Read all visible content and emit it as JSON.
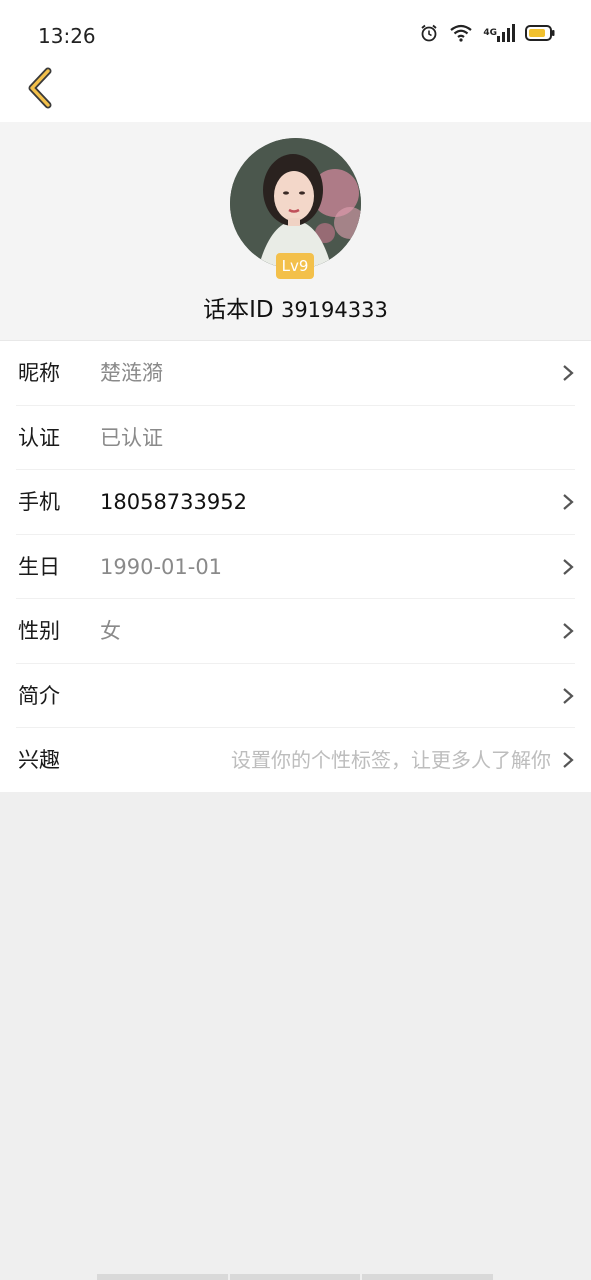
{
  "status_bar": {
    "time": "13:26",
    "network": "4G",
    "icons": [
      "alarm-icon",
      "wifi-icon",
      "signal-icon",
      "battery-icon"
    ],
    "battery_color": "#f2c12e"
  },
  "nav": {
    "back_icon": "chevron-left-icon",
    "back_color": "#f3c04a"
  },
  "profile": {
    "level_badge": "Lv9",
    "id_label": "话本ID",
    "id_value": "39194333"
  },
  "rows": [
    {
      "label": "昵称",
      "value": "楚涟漪"
    },
    {
      "label": "认证",
      "value": "已认证"
    },
    {
      "label": "手机",
      "value": "18058733952"
    },
    {
      "label": "生日",
      "value": "1990-01-01"
    },
    {
      "label": "性别",
      "value": "女"
    },
    {
      "label": "简介",
      "value": ""
    },
    {
      "label": "兴趣",
      "value": "设置你的个性标签，让更多人了解你"
    }
  ],
  "colors": {
    "accent": "#f3c04a",
    "page_bg": "#efefef",
    "header_bg": "#f4f4f4"
  }
}
